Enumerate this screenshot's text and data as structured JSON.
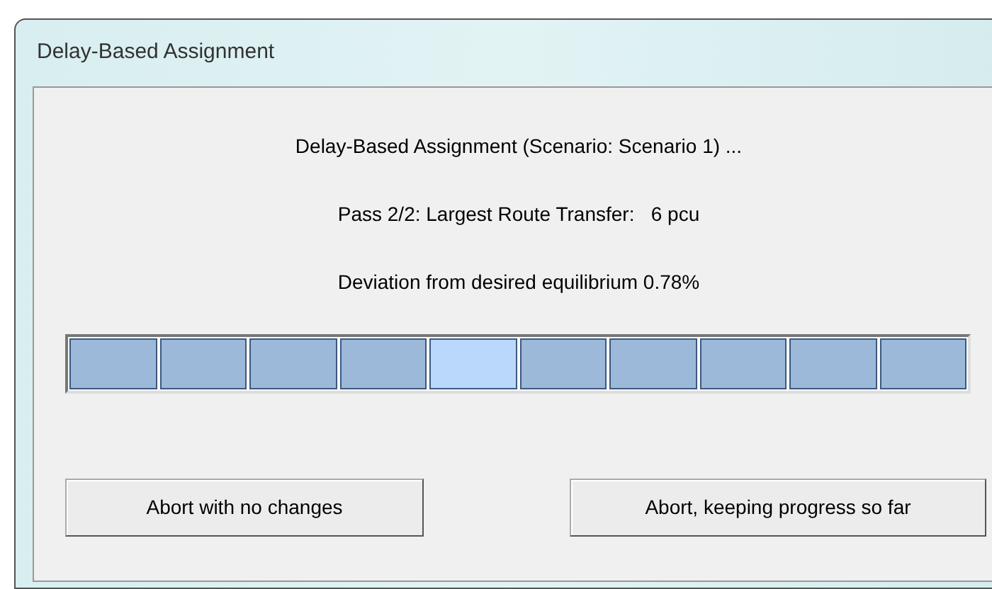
{
  "window": {
    "title": "Delay-Based Assignment"
  },
  "messages": [
    "Delay-Based Assignment (Scenario: Scenario 1) ...",
    "Pass 2/2: Largest Route Transfer:   6 pcu",
    "Deviation from desired equilibrium 0.78%"
  ],
  "progress": {
    "segments": [
      {
        "active": false
      },
      {
        "active": false
      },
      {
        "active": false
      },
      {
        "active": false
      },
      {
        "active": true
      },
      {
        "active": false
      },
      {
        "active": false
      },
      {
        "active": false
      },
      {
        "active": false
      },
      {
        "active": false
      }
    ]
  },
  "buttons": [
    "Abort with no changes",
    "Abort, keeping progress so far"
  ]
}
